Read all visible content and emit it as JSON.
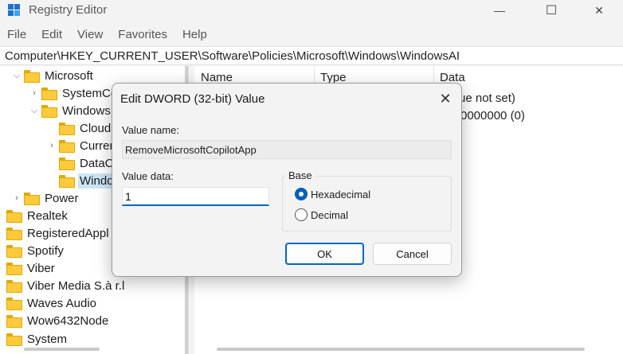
{
  "window": {
    "title": "Registry Editor",
    "minimize_glyph": "—",
    "maximize_glyph": "☐",
    "close_glyph": "✕"
  },
  "menu": [
    "File",
    "Edit",
    "View",
    "Favorites",
    "Help"
  ],
  "address": "Computer\\HKEY_CURRENT_USER\\Software\\Policies\\Microsoft\\Windows\\WindowsAI",
  "tree": {
    "items": [
      {
        "label": "Microsoft",
        "chevron": "down"
      },
      {
        "label": "SystemCe",
        "chevron": "right"
      },
      {
        "label": "Windows",
        "chevron": "down"
      },
      {
        "label": "CloudC",
        "chevron": ""
      },
      {
        "label": "Curren",
        "chevron": "right"
      },
      {
        "label": "DataCo",
        "chevron": ""
      },
      {
        "label": "Windo",
        "chevron": "",
        "selected": true
      },
      {
        "label": "Power",
        "chevron": "right"
      },
      {
        "label": "Realtek",
        "chevron": "right"
      },
      {
        "label": "RegisteredAppl",
        "chevron": "right"
      },
      {
        "label": "Spotify",
        "chevron": "right"
      },
      {
        "label": "Viber",
        "chevron": "right"
      },
      {
        "label": "Viber Media S.à r.l",
        "chevron": "right"
      },
      {
        "label": "Waves Audio",
        "chevron": "right"
      },
      {
        "label": "Wow6432Node",
        "chevron": "right"
      },
      {
        "label": "System",
        "chevron": "right"
      }
    ]
  },
  "list": {
    "columns": [
      "Name",
      "Type",
      "Data"
    ],
    "rows": [
      {
        "data": "ue not set)"
      },
      {
        "data": "0000000 (0)"
      }
    ]
  },
  "dialog": {
    "title": "Edit DWORD (32-bit) Value",
    "close_glyph": "✕",
    "value_name_label": "Value name:",
    "value_name": "RemoveMicrosoftCopilotApp",
    "value_data_label": "Value data:",
    "value_data": "1",
    "base_label": "Base",
    "base_options": [
      {
        "label": "Hexadecimal",
        "checked": true
      },
      {
        "label": "Decimal",
        "checked": false
      }
    ],
    "ok_label": "OK",
    "cancel_label": "Cancel"
  },
  "colors": {
    "accent": "#005fb8",
    "selection": "#cce4f7",
    "folder": "#ffcb3d"
  }
}
